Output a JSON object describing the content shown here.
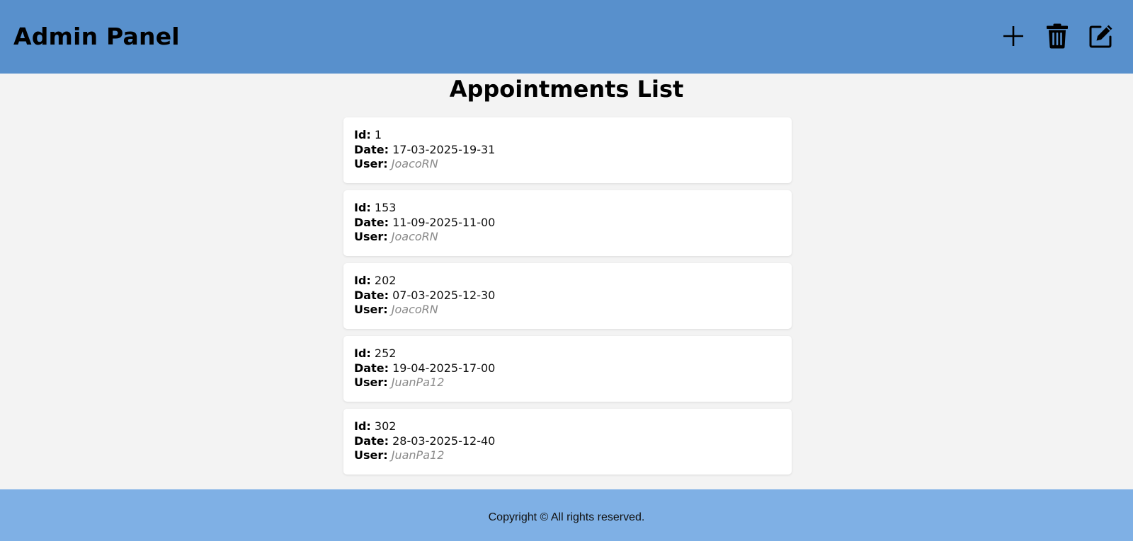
{
  "header": {
    "title": "Admin Panel",
    "actions": [
      {
        "name": "add",
        "icon": "plus-icon"
      },
      {
        "name": "delete",
        "icon": "trash-icon"
      },
      {
        "name": "edit",
        "icon": "edit-icon"
      }
    ]
  },
  "main": {
    "title": "Appointments List",
    "labels": {
      "id": "Id:",
      "date": "Date:",
      "user": "User:"
    },
    "appointments": [
      {
        "id": "1",
        "date": "17-03-2025-19-31",
        "user": "JoacoRN"
      },
      {
        "id": "153",
        "date": "11-09-2025-11-00",
        "user": "JoacoRN"
      },
      {
        "id": "202",
        "date": "07-03-2025-12-30",
        "user": "JoacoRN"
      },
      {
        "id": "252",
        "date": "19-04-2025-17-00",
        "user": "JuanPa12"
      },
      {
        "id": "302",
        "date": "28-03-2025-12-40",
        "user": "JuanPa12"
      }
    ]
  },
  "footer": {
    "copyright": "Copyright © All rights reserved."
  },
  "colors": {
    "header_bg": "#5890cc",
    "footer_bg": "#7fb0e5",
    "page_bg": "#f3f3f3",
    "card_bg": "#ffffff",
    "user_text": "#8a8a8a"
  }
}
